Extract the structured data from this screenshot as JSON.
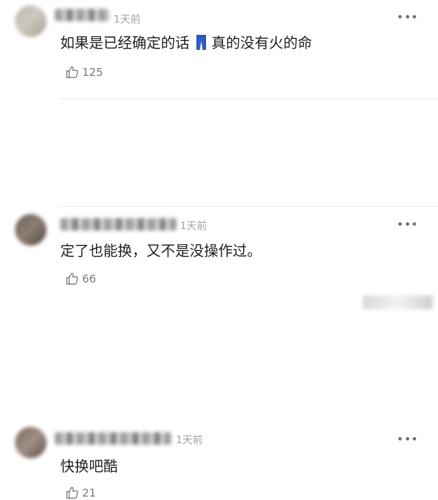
{
  "comments": [
    {
      "time": "1天前",
      "text_before_icon": "如果是已经确定的话",
      "text_after_icon": "真的没有火的命",
      "likes": "125",
      "inline_icon": "jeans-icon"
    },
    {
      "time": "1天前",
      "text": "定了也能换，又不是没操作过。",
      "likes": "66"
    },
    {
      "time": "1天前",
      "text": "快换吧酷",
      "likes": "21"
    }
  ],
  "icons": {
    "more": "ellipsis-icon",
    "like": "thumbs-up-icon"
  }
}
